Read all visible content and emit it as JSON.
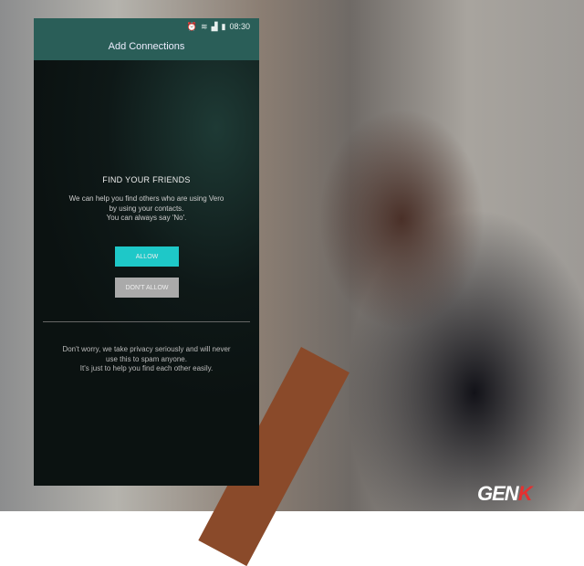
{
  "status_bar": {
    "time": "08:30",
    "icons": [
      "alarm-icon",
      "wifi-icon",
      "sim-icon",
      "signal-icon",
      "battery-icon"
    ]
  },
  "header": {
    "title": "Add Connections"
  },
  "main": {
    "title": "FIND YOUR FRIENDS",
    "description": [
      "We can help you find others who are using Vero",
      "by using your contacts.",
      "You can always say 'No'."
    ],
    "allow_label": "ALLOW",
    "deny_label": "DON'T ALLOW",
    "footer": [
      "Don't worry, we take privacy seriously and will never",
      "use this to spam anyone.",
      "It's just to help you find each other easily."
    ]
  },
  "watermark": {
    "text_main": "GEN",
    "text_accent": "K"
  },
  "colors": {
    "header": "#2a5e58",
    "allow": "#1ec8c8",
    "deny": "#aaaaaa",
    "logo_accent": "#e53030"
  }
}
